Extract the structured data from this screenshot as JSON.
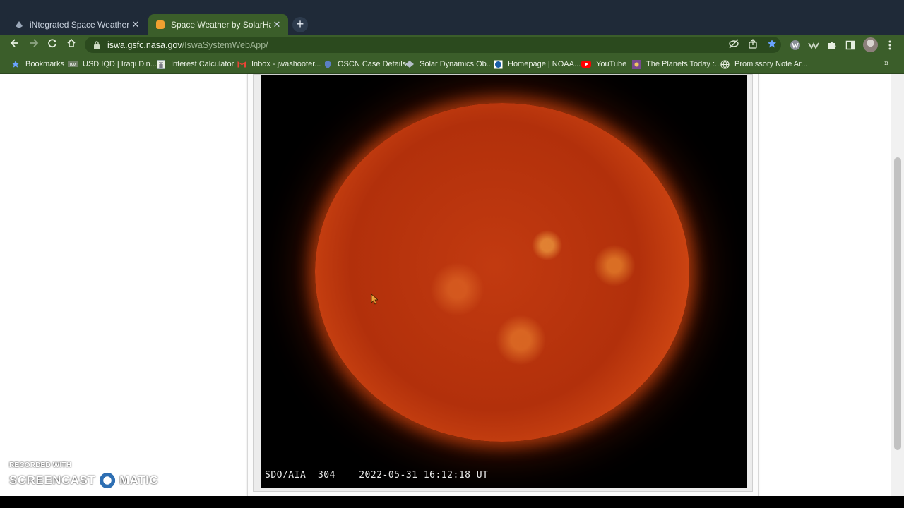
{
  "browser": {
    "tabs": [
      {
        "title": "iNtegrated Space Weather Analy",
        "favicon": "nasa-tab-icon",
        "active": false
      },
      {
        "title": "Space Weather by SolarHam",
        "favicon": "solarham-tab-icon",
        "active": true
      }
    ],
    "tab_close_glyph": "✕",
    "new_tab_glyph": "+",
    "url": {
      "host": "iswa.gsfc.nasa.gov",
      "path": "/IswaSystemWebApp/"
    },
    "bookmarks": [
      {
        "label": "Bookmarks",
        "icon": "star-icon"
      },
      {
        "label": "USD IQD | Iraqi Din...",
        "icon": "currency-icon"
      },
      {
        "label": "Interest Calculator",
        "icon": "calculator-icon"
      },
      {
        "label": "Inbox - jwashooter...",
        "icon": "gmail-icon"
      },
      {
        "label": "OSCN Case Details",
        "icon": "oscn-icon"
      },
      {
        "label": "Solar Dynamics Ob...",
        "icon": "sdo-icon"
      },
      {
        "label": "Homepage | NOAA...",
        "icon": "noaa-icon"
      },
      {
        "label": "YouTube",
        "icon": "youtube-icon"
      },
      {
        "label": "The Planets Today :...",
        "icon": "planets-icon"
      },
      {
        "label": "Promissory Note Ar...",
        "icon": "globe-icon"
      }
    ],
    "bookmarks_more_glyph": "»"
  },
  "page": {
    "image_caption": "SDO/AIA  304    2022-05-31 16:12:18 UT"
  },
  "watermark": {
    "line1": "RECORDED WITH",
    "part1": "SCREENCAST",
    "part2": "MATIC"
  },
  "colors": {
    "tab_strip": "#1f2a38",
    "toolbar": "#3b5e2a",
    "sun_core": "#c23a10"
  }
}
